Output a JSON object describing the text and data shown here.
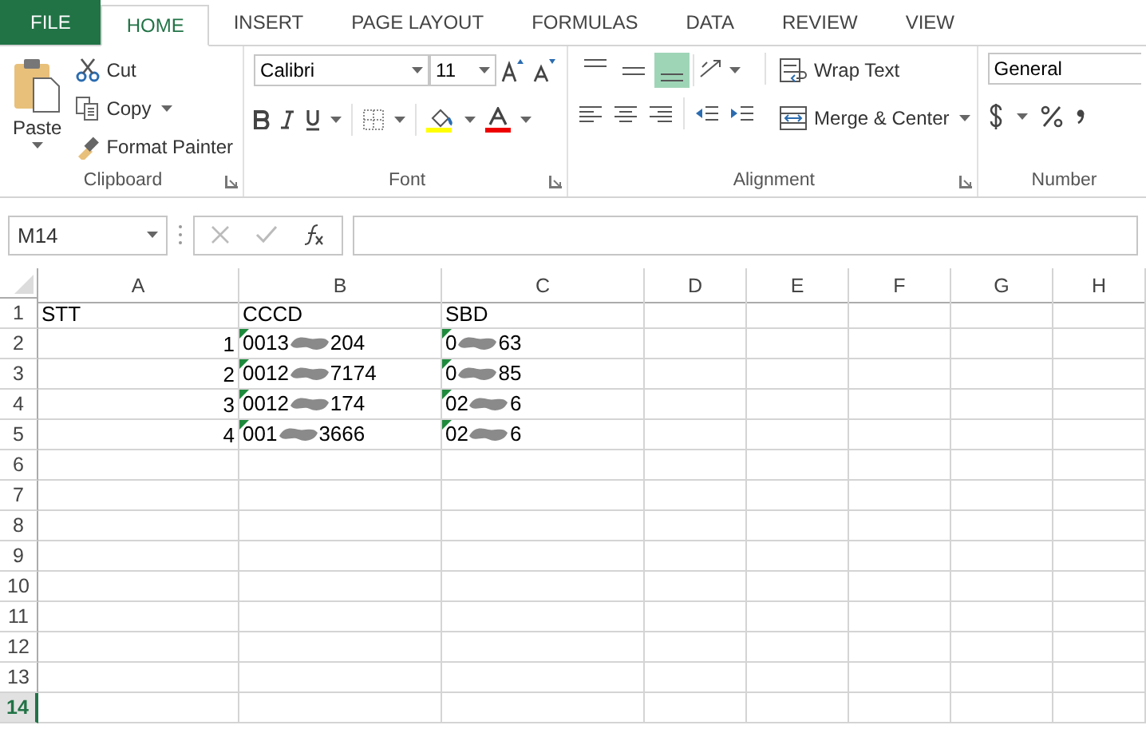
{
  "tabs": [
    {
      "label": "FILE",
      "kind": "file",
      "selected": false
    },
    {
      "label": "HOME",
      "kind": "tab",
      "selected": true
    },
    {
      "label": "INSERT",
      "kind": "tab",
      "selected": false
    },
    {
      "label": "PAGE LAYOUT",
      "kind": "tab",
      "selected": false
    },
    {
      "label": "FORMULAS",
      "kind": "tab",
      "selected": false
    },
    {
      "label": "DATA",
      "kind": "tab",
      "selected": false
    },
    {
      "label": "REVIEW",
      "kind": "tab",
      "selected": false
    },
    {
      "label": "VIEW",
      "kind": "tab",
      "selected": false
    }
  ],
  "clipboard": {
    "paste": "Paste",
    "cut": "Cut",
    "copy": "Copy",
    "format_painter": "Format Painter",
    "label": "Clipboard"
  },
  "font": {
    "name": "Calibri",
    "size": "11",
    "label": "Font"
  },
  "alignment": {
    "vertical": [
      {
        "selected": false
      },
      {
        "selected": false
      },
      {
        "selected": true
      }
    ],
    "wrap": "Wrap Text",
    "merge": "Merge & Center",
    "label": "Alignment"
  },
  "number": {
    "format": "General",
    "label": "Number"
  },
  "name_box": "M14",
  "columns": [
    "A",
    "B",
    "C",
    "D",
    "E",
    "F",
    "G",
    "H"
  ],
  "rows": [
    {
      "number": "1",
      "selected": false,
      "cells": [
        {
          "parts": [
            "STT"
          ]
        },
        {
          "parts": [
            "CCCD"
          ]
        },
        {
          "parts": [
            "SBD"
          ]
        }
      ]
    },
    {
      "number": "2",
      "selected": false,
      "cells": [
        {
          "parts": [
            "1"
          ],
          "kind": "number"
        },
        {
          "parts": [
            "0013",
            "204"
          ],
          "flag": true
        },
        {
          "parts": [
            "0",
            "63"
          ],
          "flag": true
        }
      ]
    },
    {
      "number": "3",
      "selected": false,
      "cells": [
        {
          "parts": [
            "2"
          ],
          "kind": "number"
        },
        {
          "parts": [
            "0012",
            "7174"
          ],
          "flag": true
        },
        {
          "parts": [
            "0",
            "85"
          ],
          "flag": true
        }
      ]
    },
    {
      "number": "4",
      "selected": false,
      "cells": [
        {
          "parts": [
            "3"
          ],
          "kind": "number"
        },
        {
          "parts": [
            "0012",
            "174"
          ],
          "flag": true
        },
        {
          "parts": [
            "02",
            "6"
          ],
          "flag": true
        }
      ]
    },
    {
      "number": "5",
      "selected": false,
      "cells": [
        {
          "parts": [
            "4"
          ],
          "kind": "number"
        },
        {
          "parts": [
            "001",
            "3666"
          ],
          "flag": true
        },
        {
          "parts": [
            "02",
            "6"
          ],
          "flag": true
        }
      ]
    },
    {
      "number": "6",
      "selected": false,
      "cells": []
    },
    {
      "number": "7",
      "selected": false,
      "cells": []
    },
    {
      "number": "8",
      "selected": false,
      "cells": []
    },
    {
      "number": "9",
      "selected": false,
      "cells": []
    },
    {
      "number": "10",
      "selected": false,
      "cells": []
    },
    {
      "number": "11",
      "selected": false,
      "cells": []
    },
    {
      "number": "12",
      "selected": false,
      "cells": []
    },
    {
      "number": "13",
      "selected": false,
      "cells": []
    },
    {
      "number": "14",
      "selected": true,
      "cells": []
    }
  ]
}
